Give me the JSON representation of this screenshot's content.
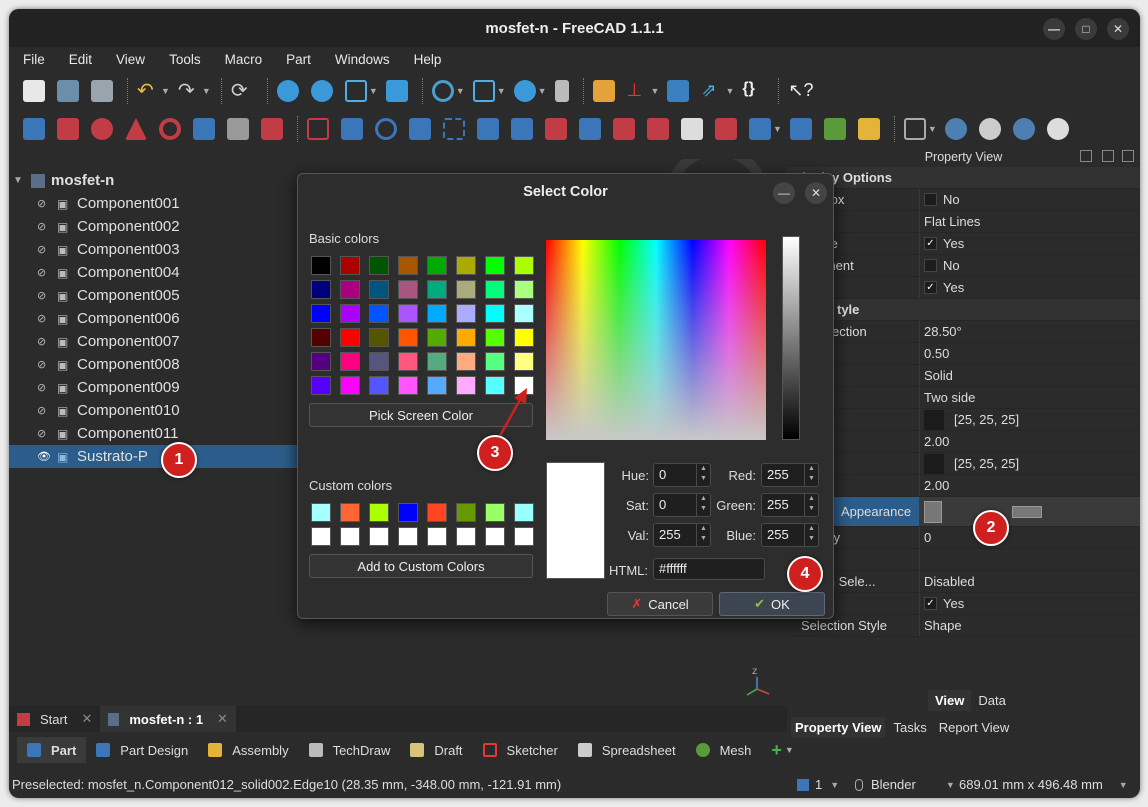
{
  "window": {
    "title": "mosfet-n - FreeCAD 1.1.1"
  },
  "menu": [
    "File",
    "Edit",
    "View",
    "Tools",
    "Macro",
    "Part",
    "Windows",
    "Help"
  ],
  "tree": {
    "root": "mosfet-n",
    "items": [
      "Component001",
      "Component002",
      "Component003",
      "Component004",
      "Component005",
      "Component006",
      "Component007",
      "Component008",
      "Component009",
      "Component010",
      "Component011",
      "Sustrato-P"
    ]
  },
  "props": {
    "panel_title": "Property View",
    "group1": "Display Options",
    "rows": [
      {
        "k": "ing Box",
        "v": "No",
        "cb": ""
      },
      {
        "k": "Mode",
        "v": "Flat Lines"
      },
      {
        "k": "n Tree",
        "v": "Yes",
        "cb": "✓"
      },
      {
        "k": "lacement",
        "v": "No",
        "cb": ""
      },
      {
        "k": "y",
        "v": "Yes",
        "cb": "✓"
      }
    ],
    "group2": "tyle",
    "rows2": [
      {
        "k": "r Deflection",
        "v": "28.50°"
      },
      {
        "k": "on",
        "v": "0.50"
      },
      {
        "k": "tyle",
        "v": "Solid"
      },
      {
        "k": "g",
        "v": "Two side"
      },
      {
        "k": "olor",
        "v": "[25, 25, 25]",
        "sw": true
      },
      {
        "k": "dth",
        "v": "2.00"
      },
      {
        "k": "olor",
        "v": "[25, 25, 25]",
        "sw": true
      },
      {
        "k": "ize",
        "v": "2.00"
      }
    ],
    "appearance_label": "Appearance",
    "rows3": [
      {
        "k": "arency",
        "v": "0"
      },
      {
        "k": "n",
        "v": ""
      },
      {
        "k": "When Sele...",
        "v": "Disabled"
      },
      {
        "k": "ble",
        "v": "Yes",
        "cb": "✓"
      },
      {
        "k": "Selection Style",
        "v": "Shape"
      }
    ],
    "tabs_top": [
      "View",
      "Data"
    ],
    "tabs_bottom": [
      "Property View",
      "Tasks",
      "Report View"
    ]
  },
  "dialog": {
    "title": "Select Color",
    "basic_label": "Basic colors",
    "pick_label": "Pick Screen Color",
    "custom_label": "Custom colors",
    "add_label": "Add to Custom Colors",
    "hue_label": "Hue:",
    "sat_label": "Sat:",
    "val_label": "Val:",
    "red_label": "Red:",
    "green_label": "Green:",
    "blue_label": "Blue:",
    "hue": "0",
    "sat": "0",
    "val": "255",
    "red": "255",
    "green": "255",
    "blue": "255",
    "html_label": "HTML:",
    "html": "#ffffff",
    "cancel": "Cancel",
    "ok": "OK",
    "basic_colors": [
      "#000000",
      "#aa0000",
      "#005500",
      "#aa5500",
      "#00aa00",
      "#aaaa00",
      "#00ff00",
      "#aaff00",
      "#00007f",
      "#aa007f",
      "#00557f",
      "#aa557f",
      "#00aa7f",
      "#aaaa7f",
      "#00ff7f",
      "#aaff7f",
      "#0000ff",
      "#aa00ff",
      "#0055ff",
      "#aa55ff",
      "#00aaff",
      "#aaaaff",
      "#00ffff",
      "#aaffff",
      "#550000",
      "#ff0000",
      "#555500",
      "#ff5500",
      "#55aa00",
      "#ffaa00",
      "#55ff00",
      "#ffff00",
      "#55007f",
      "#ff007f",
      "#55557f",
      "#ff557f",
      "#55aa7f",
      "#ffaa7f",
      "#55ff7f",
      "#ffff7f",
      "#5500ff",
      "#ff00ff",
      "#5555ff",
      "#ff55ff",
      "#55aaff",
      "#ffaaff",
      "#55ffff",
      "#ffffff"
    ],
    "custom_colors": [
      "#a6ffff",
      "#ff6633",
      "#aaff00",
      "#0000ff",
      "#ff4422",
      "#669900",
      "#99ff66",
      "#99ffff",
      "#ffffff",
      "#ffffff",
      "#ffffff",
      "#ffffff",
      "#ffffff",
      "#ffffff",
      "#ffffff",
      "#ffffff"
    ]
  },
  "badges": [
    "1",
    "2",
    "3",
    "4"
  ],
  "doc_tabs": [
    "Start",
    "mosfet-n : 1"
  ],
  "workbenches": [
    "Part",
    "Part Design",
    "Assembly",
    "TechDraw",
    "Draft",
    "Sketcher",
    "Spreadsheet",
    "Mesh"
  ],
  "status": {
    "preselected": "Preselected: mosfet_n.Component012_solid002.Edge10 (28.35 mm, -348.00 mm, -121.91 mm)",
    "pages": "1",
    "nav": "Blender",
    "dims": "689.01 mm x 496.48 mm"
  },
  "colors": {
    "accent": "#2c5d8a",
    "badge": "#d01f1f"
  }
}
